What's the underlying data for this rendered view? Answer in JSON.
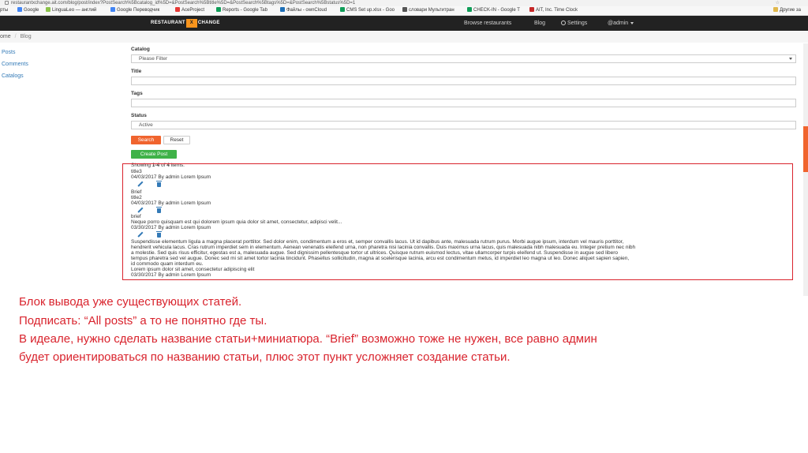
{
  "browser": {
    "url": "restaurantxchange.ait.com/blog/post/index?PostSearch%5Bcatalog_id%5D=&PostSearch%5Btitle%5D=&PostSearch%5Btags%5D=&PostSearch%5Bstatus%5D=1",
    "bookmarks": [
      {
        "label": "рты",
        "color": "#f5b7b1"
      },
      {
        "label": "Google",
        "color": "#4285f4"
      },
      {
        "label": "LinguaLeo — англий",
        "color": "#8bc34a"
      },
      {
        "label": "Google Переводчик",
        "color": "#4285f4"
      },
      {
        "label": "AceProject",
        "color": "#e53935"
      },
      {
        "label": "Reports - Google Tab",
        "color": "#0f9d58"
      },
      {
        "label": "Файлы - ownCloud",
        "color": "#1d6fb8"
      },
      {
        "label": "CMS Set up.xlsx - Goo",
        "color": "#0f9d58"
      },
      {
        "label": "словари Мультитран",
        "color": "#555555"
      },
      {
        "label": "CHECK-IN - Google T",
        "color": "#0f9d58"
      },
      {
        "label": "AIT, Inc. Time Clock",
        "color": "#c62828"
      }
    ],
    "other_bookmarks": "Другие за"
  },
  "navbar": {
    "logo_left": "RESTAURANT",
    "logo_mark": "X",
    "logo_right": "CHANGE",
    "links": [
      "Browse restaurants",
      "Blog"
    ],
    "settings": "Settings",
    "user": "@admin"
  },
  "breadcrumb": {
    "home": "ome",
    "current": "Blog"
  },
  "sidebar": {
    "items": [
      "Posts",
      "Comments",
      "Catalogs"
    ]
  },
  "form": {
    "catalog_label": "Catalog",
    "catalog_value": "Please Filter",
    "title_label": "Title",
    "title_value": "",
    "tags_label": "Tags",
    "tags_value": "",
    "status_label": "Status",
    "status_value": "Active",
    "search_button": "Search",
    "reset_button": "Reset",
    "create_button": "Create Post"
  },
  "list": {
    "summary": "Showing 1-4 of 4 items.",
    "lines": [
      "title3",
      "04/03/2017 By admin Lorem Ipsum",
      "Brief",
      "title2",
      "04/03/2017 By admin Lorem Ipsum",
      "brief",
      "Neque porro quisquam est qui dolorem ipsum quia dolor sit amet, consectetur, adipisci velit...",
      "03/30/2017 By admin Lorem Ipsum",
      "Suspendisse elementum ligula a magna placerat porttitor. Sed dolor enim, condimentum a eros et, semper convallis lacus. Ut id dapibus ante, malesuada rutrum purus. Morbi augue ipsum, interdum vel mauris porttitor,",
      "hendrerit vehicula lacus. Cras rutrum imperdiet sem in elementum. Aenean venenatis eleifend urna, non pharetra nisi lacinia convallis. Duis maximus urna lacus, quis malesuada nibh malesuada eu. Integer pretium nec nibh",
      "a molestie. Sed quis risus efficitur, egestas est a, malesuada augue. Sed dignissim pellentesque tortor ut ultrices. Quisque rutrum euismod lectus, vitae ullamcorper turpis eleifend ut. Suspendisse in augue sed libero",
      "tempus pharetra sed vel augue. Donec sed mi sit amet tortor lacinia tincidunt. Phasellus sollicitudin, magna at scelerisque lacinia, arcu est condimentum metus, id imperdiet leo magna ut leo. Donec aliquet sapien sapien,",
      "id commodo quam interdum eu.",
      "Lorem ipsum dolor sit amet, consectetur adipiscing elit",
      "03/30/2017 By admin Lorem Ipsum"
    ]
  },
  "note": {
    "lines": [
      "Блок вывода уже существующих статей.",
      "Подписать: “All posts” а то не понятно где ты.",
      "В идеале, нужно сделать название статьи+миниатюра. “Brief” возможно тоже не нужен, все равно админ",
      "будет ориентироваться по названию статьи, плюс этот пункт усложняет создание статьи."
    ]
  },
  "colors": {
    "accent": "#f0642e",
    "success": "#3fb248",
    "annotation": "#d9232d",
    "navbar": "#222222",
    "link": "#337ab7"
  }
}
